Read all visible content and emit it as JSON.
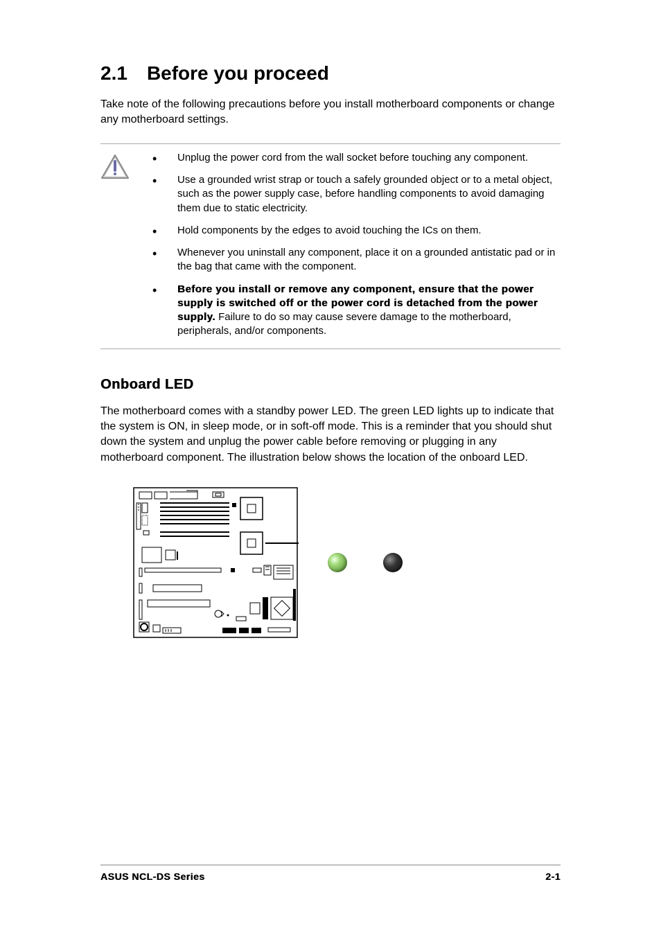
{
  "heading": {
    "number": "2.1",
    "title": "Before you proceed"
  },
  "intro": "Take note of the following precautions before you install motherboard components or change any motherboard settings.",
  "caution": {
    "icon_name": "caution-icon",
    "items": [
      {
        "text": "Unplug the power cord from the wall socket before touching any component."
      },
      {
        "text": "Use a grounded wrist strap or touch  a safely grounded object or to a metal object, such as the power supply case, before handling components to avoid damaging them due to static electricity."
      },
      {
        "text": "Hold components by the edges to avoid touching the ICs on them."
      },
      {
        "text": "Whenever you uninstall any component, place it on a grounded antistatic pad or in the bag that came with the component."
      },
      {
        "bold_lead": "Before you install or remove any component, ensure that the power supply is switched off or the power cord is detached from the power supply.",
        "rest": " Failure to do so may cause severe damage to the motherboard, peripherals, and/or components."
      }
    ]
  },
  "subsection": {
    "title": "Onboard LED",
    "body": "The motherboard comes with a standby power LED. The green LED lights up to indicate that the system is ON, in sleep mode, or in soft-off mode. This is a reminder that you should shut down the system and unplug the power cable before removing or plugging in any motherboard component. The illustration below shows the location of the onboard LED."
  },
  "leds": {
    "on_name": "led-on",
    "off_name": "led-off"
  },
  "footer": {
    "left": "ASUS NCL-DS Series",
    "right": "2-1"
  }
}
